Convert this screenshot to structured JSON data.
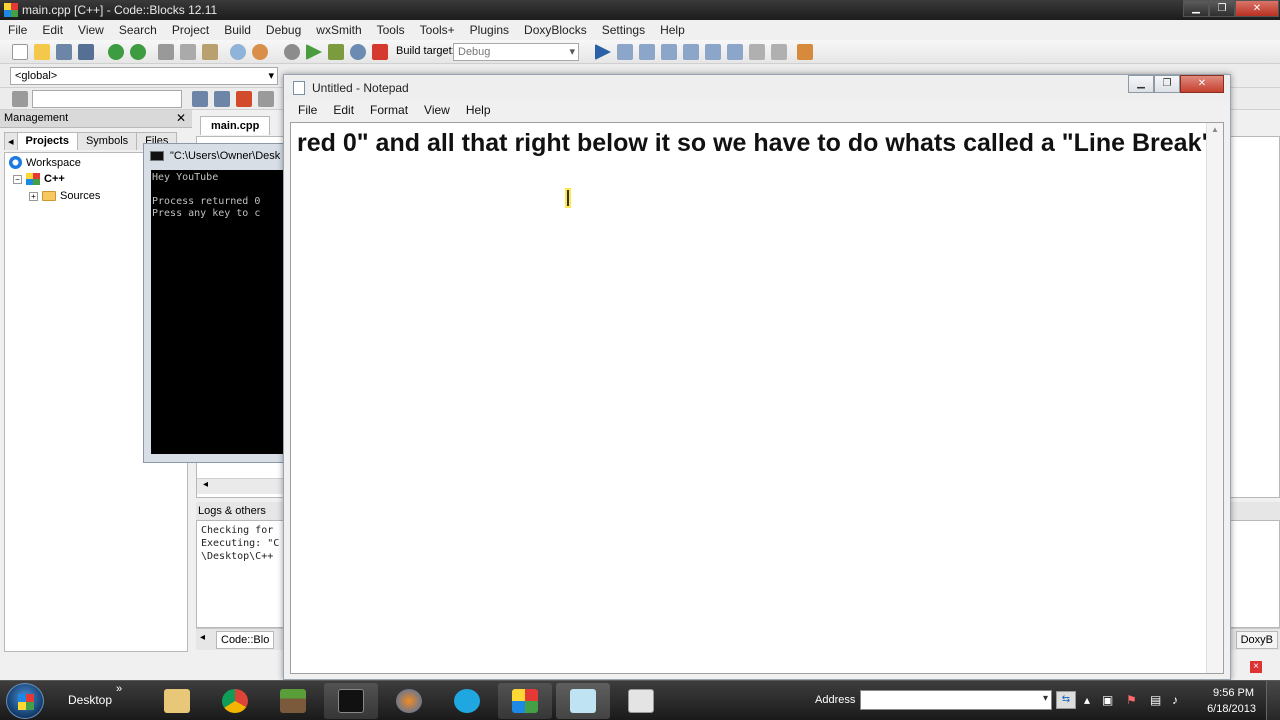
{
  "codeblocks": {
    "title": "main.cpp [C++] - Code::Blocks 12.11",
    "menu": [
      "File",
      "Edit",
      "View",
      "Search",
      "Project",
      "Build",
      "Debug",
      "wxSmith",
      "Tools",
      "Tools+",
      "Plugins",
      "DoxyBlocks",
      "Settings",
      "Help"
    ],
    "build_target_label": "Build target:",
    "build_target_value": "Debug",
    "scope_combo": "<global>",
    "management": {
      "title": "Management",
      "tabs": [
        "Projects",
        "Symbols",
        "Files"
      ],
      "tree": {
        "workspace": "Workspace",
        "project": "C++",
        "folder": "Sources"
      }
    },
    "editor_tab": "main.cpp",
    "logs": {
      "title": "Logs & others",
      "lines": [
        "Checking for",
        "Executing: \"C",
        "\\Desktop\\C++"
      ],
      "tab_label": "Code::Blo",
      "right_tab": "DoxyB"
    },
    "status_close": "×"
  },
  "console": {
    "title": "\"C:\\Users\\Owner\\Desk",
    "output": "Hey YouTube\n\nProcess returned 0\nPress any key to c"
  },
  "notepad": {
    "title": "Untitled - Notepad",
    "menu": [
      "File",
      "Edit",
      "Format",
      "View",
      "Help"
    ],
    "content": "red 0\" and all that right below it so we have to do whats called a \"Line Break\"."
  },
  "taskbar": {
    "desktop_label": "Desktop",
    "desktop_chevron": "»",
    "address_label": "Address",
    "clock_time": "9:56 PM",
    "clock_date": "6/18/2013"
  },
  "colors": {
    "title_bar": "#1c1c1c",
    "notepad_close": "#c5402f",
    "taskbar": "#1a1a1a"
  }
}
